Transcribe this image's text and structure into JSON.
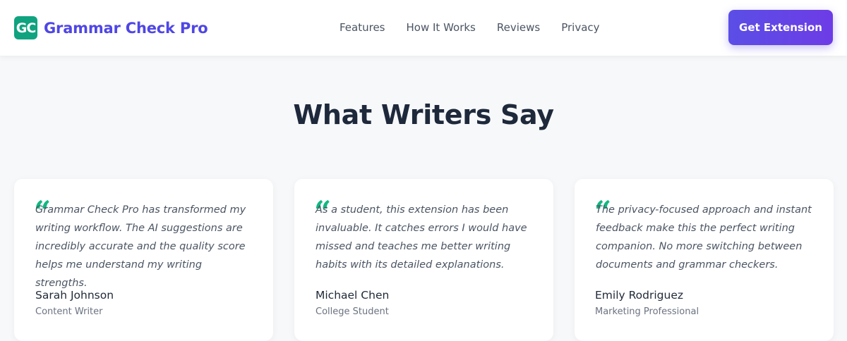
{
  "header": {
    "logo_badge": "GC",
    "logo_text": "Grammar Check Pro",
    "nav": [
      "Features",
      "How It Works",
      "Reviews",
      "Privacy"
    ],
    "cta_label": "Get Extension"
  },
  "section": {
    "title": "What Writers Say"
  },
  "testimonials": [
    {
      "quote_mark": "“",
      "quote": "Grammar Check Pro has transformed my writing workflow. The AI suggestions are incredibly accurate and the quality score helps me understand my writing strengths.",
      "author": "Sarah Johnson",
      "role": "Content Writer"
    },
    {
      "quote_mark": "“",
      "quote": "As a student, this extension has been invaluable. It catches errors I would have missed and teaches me better writing habits with its detailed explanations.",
      "author": "Michael Chen",
      "role": "College Student"
    },
    {
      "quote_mark": "“",
      "quote": "The privacy-focused approach and instant feedback make this the perfect writing companion. No more switching between documents and grammar checkers.",
      "author": "Emily Rodriguez",
      "role": "Marketing Professional"
    }
  ],
  "colors": {
    "brand": "#4f46e5",
    "accent": "#10a37f",
    "quote_mark": "#10b981",
    "cta_start": "#5b4ee6",
    "cta_end": "#6d3ce6"
  }
}
